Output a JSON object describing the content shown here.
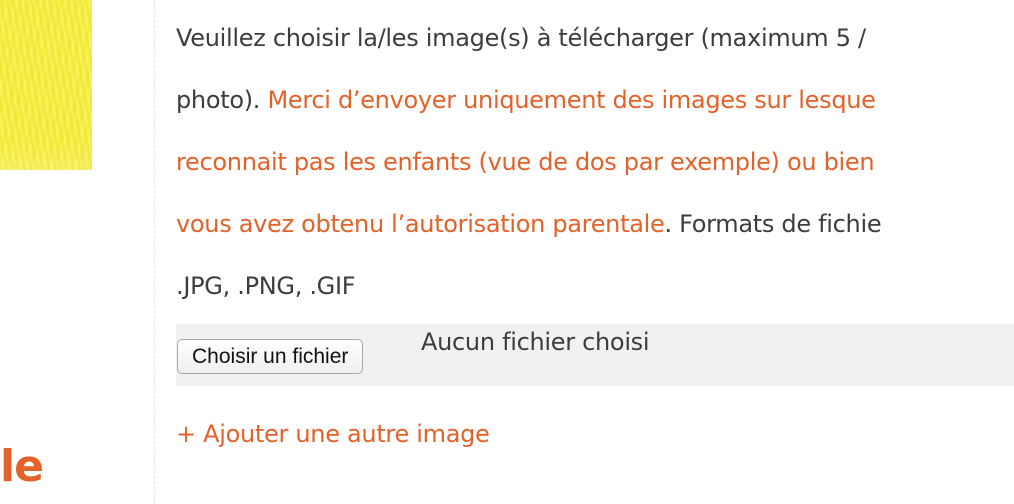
{
  "sidebar": {
    "heading_fragment": "le",
    "image_icon": "crayon-drawing-image"
  },
  "instructions": {
    "line1": "Veuillez choisir la/les image(s) à télécharger (maximum 5 /",
    "line2_plain": "photo). ",
    "line2_warning": "Merci d’envoyer uniquement des images sur lesque",
    "line3_warning": "reconnait pas les enfants (vue de dos par exemple) ou bien",
    "line4_warning": "vous avez obtenu l’autorisation parentale",
    "line4_plain": ". Formats de fichie",
    "line5": ".JPG, .PNG, .GIF"
  },
  "file_input": {
    "button_label": "Choisir un fichier",
    "status": "Aucun fichier choisi"
  },
  "add_image_link": "+ Ajouter une autre image",
  "colors": {
    "accent": "#e2622a",
    "text": "#3d3d3d",
    "file_row_bg": "#f1f1f1"
  }
}
